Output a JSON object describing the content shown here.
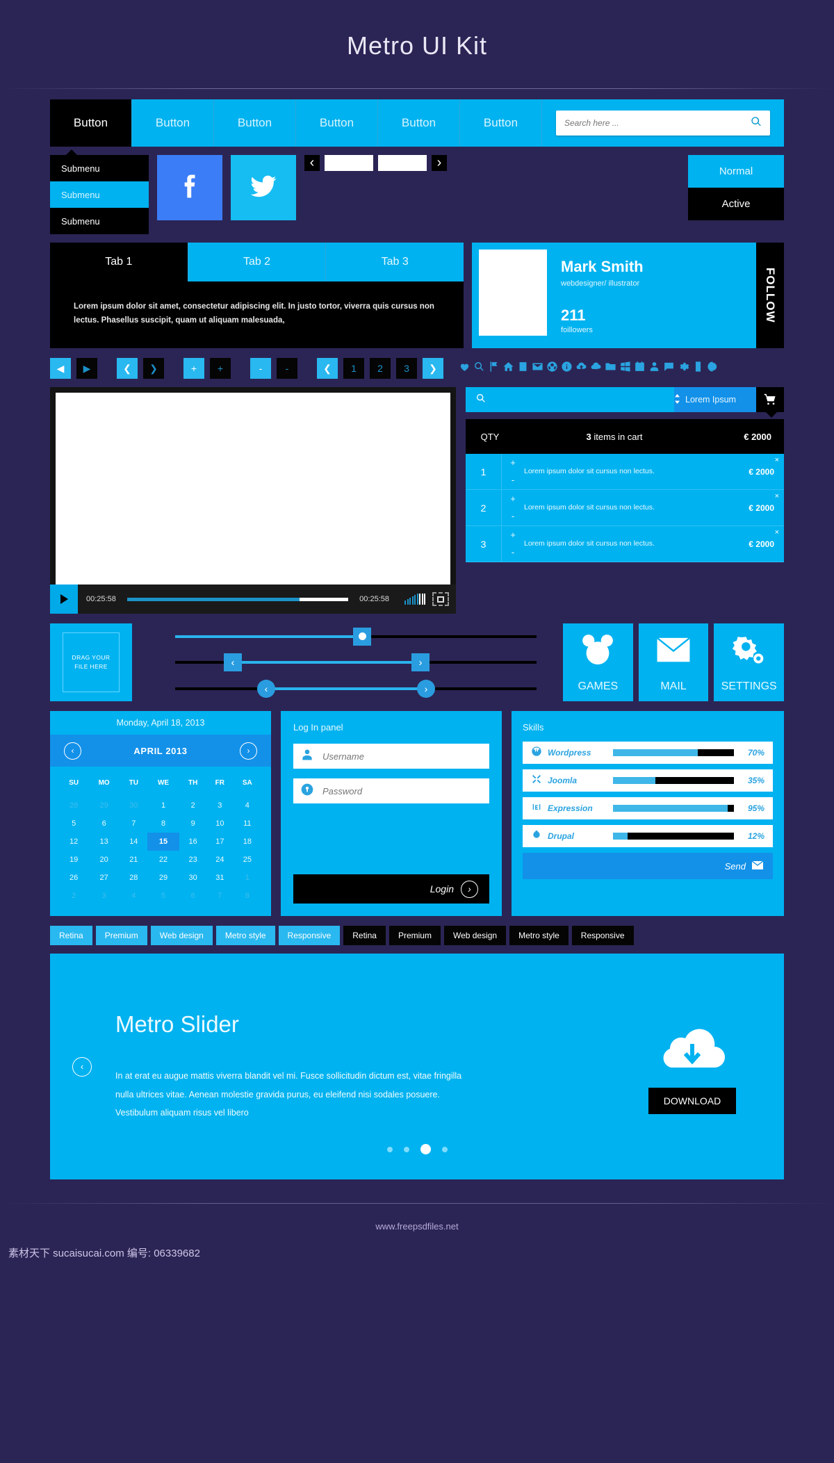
{
  "header": {
    "title": "Metro UI Kit"
  },
  "navbar": {
    "buttons": [
      {
        "label": "Button",
        "active": true
      },
      {
        "label": "Button",
        "active": false
      },
      {
        "label": "Button",
        "active": false
      },
      {
        "label": "Button",
        "active": false
      },
      {
        "label": "Button",
        "active": false
      },
      {
        "label": "Button",
        "active": false
      }
    ],
    "search": {
      "placeholder": "Search here ...",
      "value": "",
      "icon": "search-icon"
    }
  },
  "submenu": {
    "items": [
      {
        "label": "Submenu",
        "selected": false
      },
      {
        "label": "Submenu",
        "selected": true
      },
      {
        "label": "Submenu",
        "selected": false
      }
    ]
  },
  "social": [
    {
      "name": "facebook-icon",
      "color": "#3b7df6"
    },
    {
      "name": "twitter-icon",
      "color": "#16bdf2"
    }
  ],
  "carousel": {
    "prev": "‹",
    "next": "›"
  },
  "state_buttons": [
    {
      "label": "Normal",
      "state": "normal"
    },
    {
      "label": "Active",
      "state": "active"
    }
  ],
  "tabs": {
    "items": [
      {
        "label": "Tab 1",
        "active": true
      },
      {
        "label": "Tab 2",
        "active": false
      },
      {
        "label": "Tab 3",
        "active": false
      }
    ],
    "body": "Lorem ipsum dolor sit amet, consectetur adipiscing elit. In justo tortor, viverra quis cursus non lectus. Phasellus suscipit, quam ut aliquam malesuada,"
  },
  "profile": {
    "name": "Mark Smith",
    "role": "webdesigner/ illustrator",
    "count": "211",
    "count_label": "foillowers",
    "follow_label": "FOLLOW"
  },
  "pager": {
    "controls": [
      {
        "glyph": "◀",
        "style": "blue"
      },
      {
        "glyph": "▶",
        "style": "dark"
      },
      {
        "glyph": "❮",
        "style": "blue"
      },
      {
        "glyph": "❯",
        "style": "dark"
      },
      {
        "glyph": "+",
        "style": "blue"
      },
      {
        "glyph": "+",
        "style": "dark"
      },
      {
        "glyph": "-",
        "style": "blue"
      },
      {
        "glyph": "-",
        "style": "dark"
      }
    ],
    "pages": [
      {
        "glyph": "❮",
        "style": "blue"
      },
      {
        "glyph": "1",
        "style": "dark"
      },
      {
        "glyph": "2",
        "style": "dark"
      },
      {
        "glyph": "3",
        "style": "dark"
      },
      {
        "glyph": "❯",
        "style": "blue"
      }
    ]
  },
  "icon_strip": [
    "heart-icon",
    "search-icon",
    "flag-icon",
    "home-icon",
    "book-icon",
    "mail-icon",
    "soccer-ball-icon",
    "info-icon",
    "cloud-upload-icon",
    "cloud-download-icon",
    "folder-icon",
    "windows-icon",
    "calendar-icon",
    "user-icon",
    "chat-icon",
    "gear-icon",
    "phone-icon",
    "contrast-icon"
  ],
  "video": {
    "play_icon": "play-icon",
    "current_time": "00:25:58",
    "total_time": "00:25:58",
    "progress_pct": 78,
    "volume_icon": "volume-bars-icon",
    "fullscreen_icon": "fullscreen-icon"
  },
  "shop": {
    "search_placeholder": "",
    "search_icon": "search-icon",
    "select_value": "Lorem Ipsum",
    "select_icon": "updown-arrows-icon",
    "cart_icon": "shopping-cart-icon",
    "header": {
      "qty_label": "QTY",
      "items_text_bold": "3",
      "items_text": "items in cart",
      "total": "€ 2000"
    },
    "rows": [
      {
        "qty": "1",
        "desc": "Lorem ipsum dolor sit cursus non lectus.",
        "price": "€ 2000",
        "plus": "+",
        "minus": "-",
        "remove": "×"
      },
      {
        "qty": "2",
        "desc": "Lorem ipsum dolor sit cursus non lectus.",
        "price": "€ 2000",
        "plus": "+",
        "minus": "-",
        "remove": "×"
      },
      {
        "qty": "3",
        "desc": "Lorem ipsum dolor sit cursus non lectus.",
        "price": "€ 2000",
        "plus": "+",
        "minus": "-",
        "remove": "×"
      }
    ]
  },
  "dropzone": {
    "line1": "DRAG YOUR",
    "line2": "FILE HERE"
  },
  "sliders": [
    {
      "type": "single-square",
      "fill_pct": 50,
      "handle_icon": "circle-dot-handle"
    },
    {
      "type": "range-square",
      "start_pct": 18,
      "end_pct": 76,
      "left_icon": "‹",
      "right_icon": "›"
    },
    {
      "type": "range-circle",
      "start_pct": 30,
      "end_pct": 78,
      "left_icon": "‹",
      "right_icon": "›"
    }
  ],
  "tiles": [
    {
      "label": "GAMES",
      "icon": "mickey-mouse-icon"
    },
    {
      "label": "MAIL",
      "icon": "envelope-icon"
    },
    {
      "label": "SETTINGS",
      "icon": "gears-icon"
    }
  ],
  "calendar": {
    "today": "Monday, April 18, 2013",
    "month": "APRIL 2013",
    "prev": "‹",
    "next": "›",
    "weekdays": [
      "SU",
      "MO",
      "TU",
      "WE",
      "TH",
      "FR",
      "SA"
    ],
    "weeks": [
      [
        {
          "d": "28",
          "mute": true
        },
        {
          "d": "29",
          "mute": true
        },
        {
          "d": "30",
          "mute": true
        },
        {
          "d": "1"
        },
        {
          "d": "2"
        },
        {
          "d": "3"
        },
        {
          "d": "4"
        }
      ],
      [
        {
          "d": "5"
        },
        {
          "d": "6"
        },
        {
          "d": "7"
        },
        {
          "d": "8"
        },
        {
          "d": "9"
        },
        {
          "d": "10"
        },
        {
          "d": "11"
        }
      ],
      [
        {
          "d": "12"
        },
        {
          "d": "13"
        },
        {
          "d": "14"
        },
        {
          "d": "15",
          "sel": true
        },
        {
          "d": "16"
        },
        {
          "d": "17"
        },
        {
          "d": "18"
        }
      ],
      [
        {
          "d": "19"
        },
        {
          "d": "20"
        },
        {
          "d": "21"
        },
        {
          "d": "22"
        },
        {
          "d": "23"
        },
        {
          "d": "24"
        },
        {
          "d": "25"
        }
      ],
      [
        {
          "d": "26"
        },
        {
          "d": "27"
        },
        {
          "d": "28"
        },
        {
          "d": "29"
        },
        {
          "d": "30"
        },
        {
          "d": "31"
        },
        {
          "d": "1",
          "mute": true
        }
      ],
      [
        {
          "d": "2",
          "mute": true
        },
        {
          "d": "3",
          "mute": true
        },
        {
          "d": "4",
          "mute": true
        },
        {
          "d": "5",
          "mute": true
        },
        {
          "d": "6",
          "mute": true
        },
        {
          "d": "7",
          "mute": true
        },
        {
          "d": "8",
          "mute": true
        }
      ]
    ]
  },
  "login": {
    "title": "Log In panel",
    "username_placeholder": "Username",
    "username_value": "",
    "username_icon": "user-icon",
    "password_placeholder": "Password",
    "password_value": "",
    "password_icon": "lock-icon",
    "button_label": "Login",
    "button_icon": "chevron-right-icon"
  },
  "skills": {
    "title": "Skills",
    "items": [
      {
        "name": "Wordpress",
        "pct": 70,
        "pct_label": "70%",
        "icon": "wordpress-icon"
      },
      {
        "name": "Joomla",
        "pct": 35,
        "pct_label": "35%",
        "icon": "joomla-icon"
      },
      {
        "name": "Expression",
        "pct": 95,
        "pct_label": "95%",
        "icon": "expression-icon"
      },
      {
        "name": "Drupal",
        "pct": 12,
        "pct_label": "12%",
        "icon": "drupal-icon"
      }
    ],
    "send_label": "Send",
    "send_icon": "envelope-icon"
  },
  "tags": [
    {
      "label": "Retina",
      "style": "blue"
    },
    {
      "label": "Premium",
      "style": "blue"
    },
    {
      "label": "Web design",
      "style": "blue"
    },
    {
      "label": "Metro style",
      "style": "blue"
    },
    {
      "label": "Responsive",
      "style": "blue"
    },
    {
      "label": "Retina",
      "style": "dark"
    },
    {
      "label": "Premium",
      "style": "dark"
    },
    {
      "label": "Web design",
      "style": "dark"
    },
    {
      "label": "Metro style",
      "style": "dark"
    },
    {
      "label": "Responsive",
      "style": "dark"
    }
  ],
  "metro_slider": {
    "title": "Metro Slider",
    "text": "In at erat eu augue mattis viverra blandit vel mi. Fusce sollicitudin dictum est, vitae fringilla nulla ultrices vitae. Aenean molestie gravida purus, eu eleifend nisi sodales posuere. Vestibulum aliquam risus vel libero",
    "prev": "‹",
    "next": "›",
    "download_label": "DOWNLOAD",
    "cloud_icon": "cloud-download-icon",
    "dots": [
      {
        "active": false
      },
      {
        "active": false
      },
      {
        "active": true
      },
      {
        "active": false
      }
    ]
  },
  "footer": {
    "text": "www.freepsdfiles.net",
    "watermark": "素材天下 sucaisucai.com  编号: 06339682"
  },
  "colors": {
    "accent": "#00b2f0",
    "accent_dark": "#1391e9",
    "bg": "#2b2555",
    "black": "#000000"
  }
}
